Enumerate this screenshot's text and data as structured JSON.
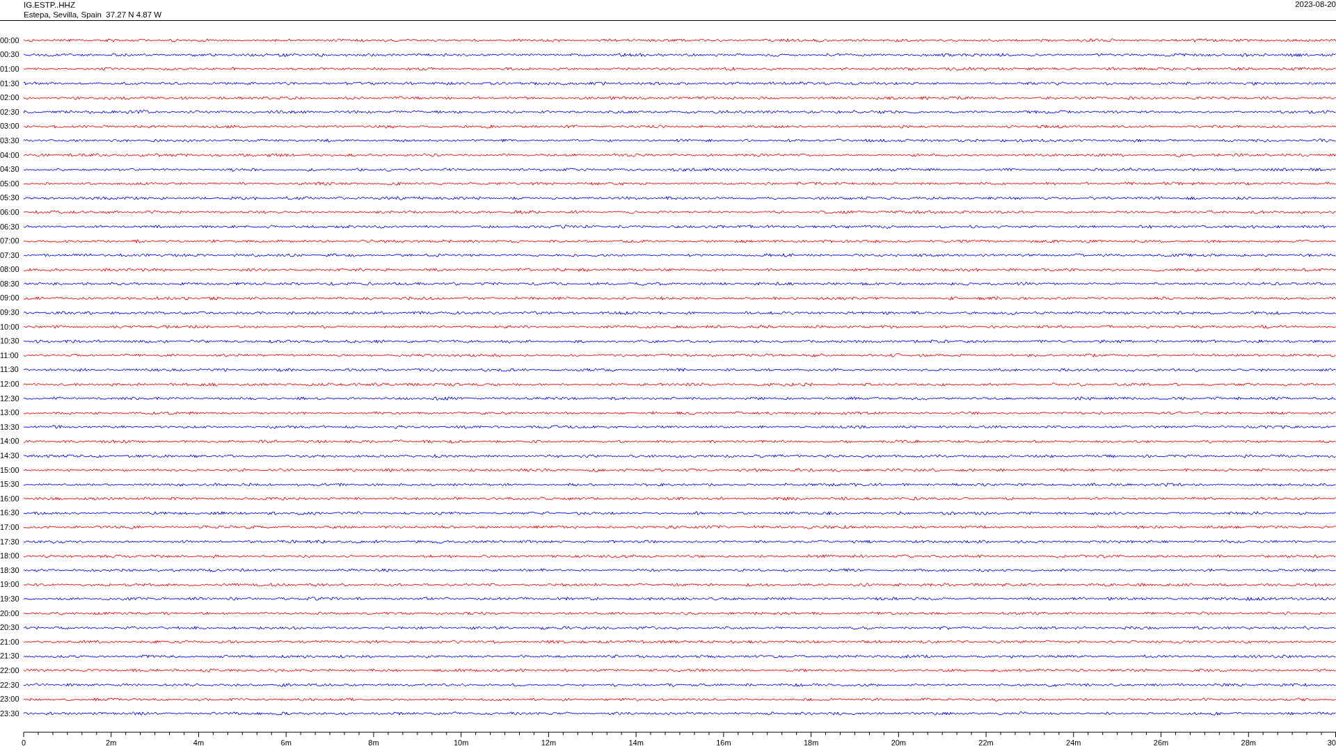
{
  "header": {
    "station": "IG.ESTP..HHZ",
    "location": "Estepa, Sevilla, Spain  37.27 N 4.87 W",
    "date": "2023-08-20"
  },
  "rows": [
    {
      "label": "00:00",
      "color": "#ff0000"
    },
    {
      "label": "00:30",
      "color": "#0000ff"
    },
    {
      "label": "01:00",
      "color": "#ff0000"
    },
    {
      "label": "01:30",
      "color": "#0000ff"
    },
    {
      "label": "02:00",
      "color": "#ff0000"
    },
    {
      "label": "02:30",
      "color": "#0000ff"
    },
    {
      "label": "03:00",
      "color": "#ff0000"
    },
    {
      "label": "03:30",
      "color": "#0000ff"
    },
    {
      "label": "04:00",
      "color": "#ff0000"
    },
    {
      "label": "04:30",
      "color": "#0000ff"
    },
    {
      "label": "05:00",
      "color": "#ff0000"
    },
    {
      "label": "05:30",
      "color": "#0000ff"
    },
    {
      "label": "06:00",
      "color": "#ff0000"
    },
    {
      "label": "06:30",
      "color": "#0000ff"
    },
    {
      "label": "07:00",
      "color": "#ff0000"
    },
    {
      "label": "07:30",
      "color": "#0000ff"
    },
    {
      "label": "08:00",
      "color": "#ff0000"
    },
    {
      "label": "08:30",
      "color": "#0000ff"
    },
    {
      "label": "09:00",
      "color": "#ff0000"
    },
    {
      "label": "09:30",
      "color": "#0000ff"
    },
    {
      "label": "10:00",
      "color": "#ff0000"
    },
    {
      "label": "10:30",
      "color": "#0000ff"
    },
    {
      "label": "11:00",
      "color": "#ff0000"
    },
    {
      "label": "11:30",
      "color": "#0000ff"
    },
    {
      "label": "12:00",
      "color": "#ff0000"
    },
    {
      "label": "12:30",
      "color": "#0000ff"
    },
    {
      "label": "13:00",
      "color": "#ff0000"
    },
    {
      "label": "13:30",
      "color": "#0000ff"
    },
    {
      "label": "14:00",
      "color": "#ff0000"
    },
    {
      "label": "14:30",
      "color": "#0000ff"
    },
    {
      "label": "15:00",
      "color": "#ff0000"
    },
    {
      "label": "15:30",
      "color": "#0000ff"
    },
    {
      "label": "16:00",
      "color": "#ff0000"
    },
    {
      "label": "16:30",
      "color": "#0000ff"
    },
    {
      "label": "17:00",
      "color": "#ff0000"
    },
    {
      "label": "17:30",
      "color": "#0000ff"
    },
    {
      "label": "18:00",
      "color": "#ff0000"
    },
    {
      "label": "18:30",
      "color": "#0000ff"
    },
    {
      "label": "19:00",
      "color": "#ff0000"
    },
    {
      "label": "19:30",
      "color": "#0000ff"
    },
    {
      "label": "20:00",
      "color": "#ff0000"
    },
    {
      "label": "20:30",
      "color": "#0000ff"
    },
    {
      "label": "21:00",
      "color": "#ff0000"
    },
    {
      "label": "21:30",
      "color": "#0000ff"
    },
    {
      "label": "22:00",
      "color": "#ff0000"
    },
    {
      "label": "22:30",
      "color": "#0000ff"
    },
    {
      "label": "23:00",
      "color": "#ff0000"
    },
    {
      "label": "23:30",
      "color": "#0000ff"
    }
  ],
  "axis": {
    "labels": [
      "0",
      "2m",
      "4m",
      "6m",
      "8m",
      "10m",
      "12m",
      "14m",
      "16m",
      "18m",
      "20m",
      "22m",
      "24m",
      "26m",
      "28m",
      "30"
    ]
  }
}
